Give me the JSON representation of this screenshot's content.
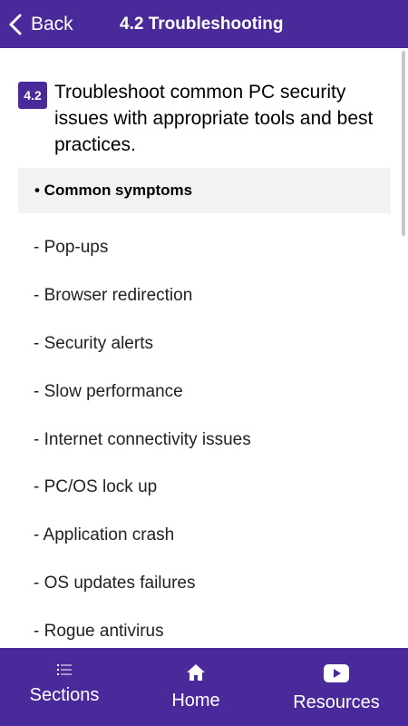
{
  "header": {
    "back_label": "Back",
    "title": "4.2 Troubleshooting"
  },
  "objective": {
    "number": "4.2",
    "text": "Troubleshoot common PC security issues with appropriate tools and best practices."
  },
  "section": {
    "heading": "• Common symptoms"
  },
  "symptoms": [
    "- Pop-ups",
    "- Browser redirection",
    "- Security alerts",
    "- Slow performance",
    "- Internet connectivity issues",
    "- PC/OS lock up",
    "- Application crash",
    "- OS updates failures",
    "- Rogue antivirus"
  ],
  "bottom_nav": {
    "sections_label": "Sections",
    "home_label": "Home",
    "resources_label": "Resources",
    "sections_icon": "list-icon",
    "home_icon": "home-icon",
    "resources_icon": "youtube-icon"
  },
  "colors": {
    "brand": "#4a2a9b",
    "section_bg": "#f2f2f2"
  }
}
